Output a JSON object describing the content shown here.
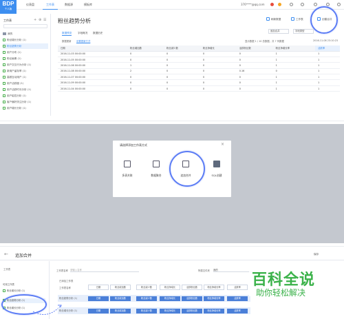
{
  "panel1": {
    "logo": {
      "title": "BDP",
      "subtitle": "个人版"
    },
    "nav": [
      "仪表盘",
      "工作表",
      "数据源",
      "模板库"
    ],
    "user_text": "376****@qq.com",
    "sidebar": {
      "title": "工作表",
      "tools": [
        "+",
        "⊕",
        "☰"
      ],
      "folder": "我的",
      "items": [
        "粉丝增长分析 (1)",
        "粉丝趋势分析",
        "用户分布 (1)",
        "粉丝画像 (1)",
        "用户交互行为分析 (1)",
        "新用户留存率 (1)",
        "高频互动用户 (1)",
        "用户活跃度 (1)",
        "用户活跃时长分析 (1)",
        "用户粘性分析 (1)",
        "客户偏好关注分析 (1)",
        "用户增长分析 (1)"
      ]
    },
    "title": "粉丝趋势分析",
    "actions": [
      "刷新数据",
      "工作表",
      "创建合并"
    ],
    "subtabs": [
      "数据预览",
      "字段概况",
      "数据历史"
    ],
    "controls_left": [
      "数据更新",
      "设置更新方式"
    ],
    "controls_right": "显示数据 1 / 10 总数据，共 7 列数据",
    "select_1": "追加合并",
    "select_2": "字段类型",
    "update_time": "2016-11-08 23:10:23",
    "table": {
      "columns": [
        "日期",
        "粉丝增加数",
        "粉丝减少数",
        "粉丝净增长",
        "活跃粉丝数",
        "粉丝净增长率",
        "活跃率"
      ],
      "rows": [
        [
          "2016-11-03 00:00:00",
          "0",
          "0",
          "0",
          "0",
          "1",
          "1"
        ],
        [
          "2016-11-05 00:00:00",
          "0",
          "0",
          "0",
          "0",
          "1",
          "1"
        ],
        [
          "2016-11-06 00:00:00",
          "1",
          "0",
          "0",
          "0",
          "1",
          "1"
        ],
        [
          "2016-11-08 00:00:00",
          "2",
          "0",
          "0",
          "0.16",
          "0",
          "1"
        ],
        [
          "2016-11-07 00:00:00",
          "0",
          "0",
          "0",
          "0",
          "1",
          "1"
        ],
        [
          "2016-11-09 00:00:00",
          "0",
          "0",
          "0",
          "0",
          "1",
          "1"
        ],
        [
          "2016-11-04 00:00:00",
          "0",
          "0",
          "0",
          "0",
          "1",
          "1"
        ]
      ]
    }
  },
  "panel2": {
    "modal_title": "请选择添加工作表方式",
    "close": "×",
    "options": [
      "多表关联",
      "数据聚合",
      "追加合并",
      "SQL创建"
    ]
  },
  "panel3": {
    "title": "追加合并",
    "save": "保存",
    "sidebar": {
      "title": "工作表",
      "items": [
        "可用工作表",
        "粉丝增长分析 (1)",
        "粉丝趋势分析 (1)",
        "粉丝增长分析 (1)"
      ]
    },
    "form": {
      "name_label": "工作表名称",
      "name_placeholder": "请输入名称",
      "folder_label": "所属文件夹",
      "folder_value": "我的"
    },
    "hint": "已添加工作表",
    "header_label": "工作表名称",
    "columns": [
      "日期",
      "粉丝增加数",
      "粉丝减少数",
      "粉丝净增长",
      "活跃粉丝数",
      "粉丝净增长率",
      "活跃率"
    ],
    "row_labels": [
      "粉丝趋势分析 (1)",
      "粉丝增长分析 (1)"
    ],
    "blue_cells": [
      "日期",
      "粉丝增加数",
      "粉丝减少数",
      "粉丝净增长",
      "活跃粉丝数",
      "粉丝净增长率",
      "活跃率"
    ]
  },
  "watermark": {
    "title": "百科全说",
    "subtitle": "助你轻松解决"
  },
  "colors": {
    "accent": "#3d8ef0",
    "highlight_ring": "#5b7cf5",
    "watermark": "#3bb24a",
    "overlay": "#c4c8cf"
  }
}
